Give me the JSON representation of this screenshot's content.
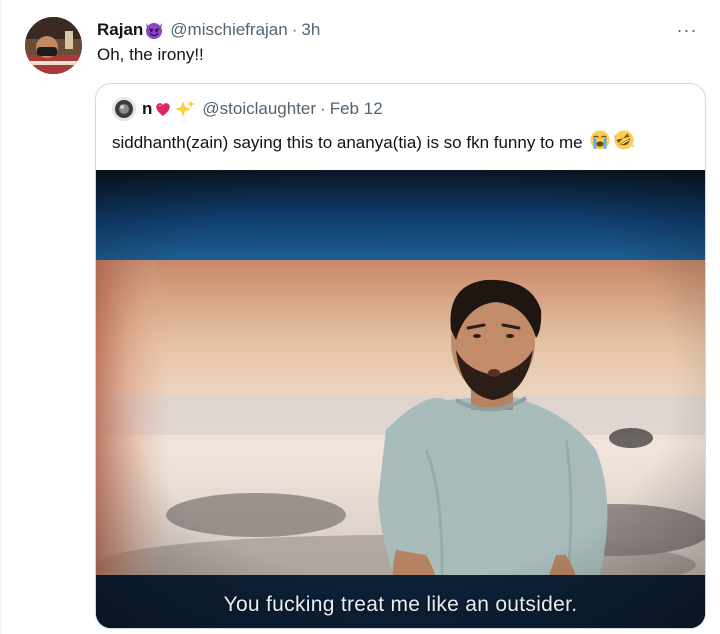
{
  "tweet": {
    "display_name": "Rajan",
    "name_emoji": "smiling-devil-emoji",
    "handle": "@mischiefrajan",
    "separator": "·",
    "time": "3h",
    "text": "Oh, the irony!!",
    "more_label": "···"
  },
  "quote": {
    "display_name": "n",
    "name_emojis": [
      "heart-emoji",
      "sparkles-emoji"
    ],
    "handle": "@stoiclaughter",
    "separator": "·",
    "time": "Feb 12",
    "text": "siddhanth(zain) saying this to ananya(tia) is so fkn funny to me",
    "text_emojis": [
      "crying-emoji",
      "rofl-emoji"
    ],
    "media": {
      "subtitle": "You fucking treat me like an outsider."
    }
  },
  "colors": {
    "text_primary": "#0f1419",
    "text_secondary": "#536471",
    "border": "#cfd9de",
    "devil_purple": "#8b44c9",
    "heart_red": "#e0245e",
    "sparkle_yellow": "#ffcc33"
  }
}
